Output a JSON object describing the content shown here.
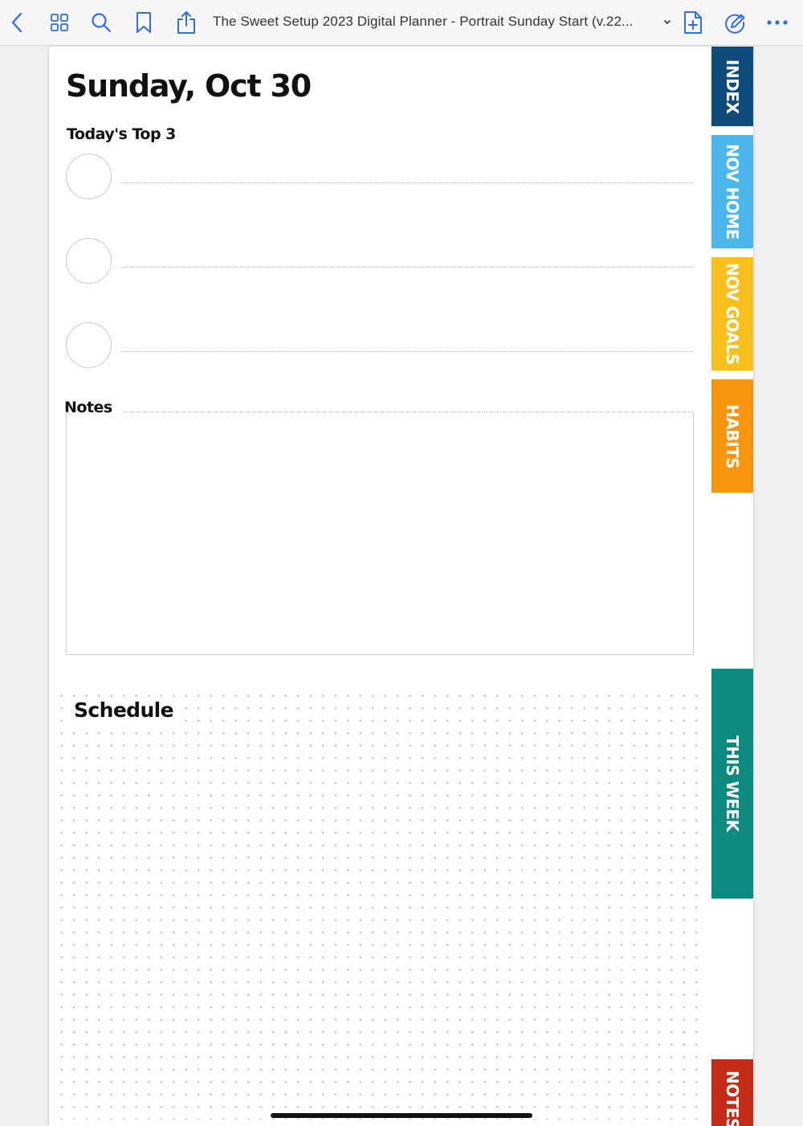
{
  "toolbar": {
    "document_title": "The Sweet Setup 2023 Digital Planner - Portrait Sunday Start (v.22...",
    "accent_color": "#2f6ee6",
    "icons": [
      "back-chevron-icon",
      "grid-icon",
      "search-icon",
      "bookmark-icon",
      "share-icon",
      "title-chevron-down-icon",
      "add-page-icon",
      "pencil-circle-icon",
      "more-icon"
    ]
  },
  "page": {
    "day_title": "Sunday, Oct 30",
    "top3_heading": "Today's Top 3",
    "notes_heading": "Notes",
    "schedule_heading": "Schedule"
  },
  "tabs": {
    "index": "INDEX",
    "nov_home": "NOV HOME",
    "nov_goals": "NOV GOALS",
    "habits": "HABITS",
    "this_week": "THIS WEEK",
    "notes": "NOTES"
  },
  "tab_colors": {
    "index": "#0f4c7c",
    "nov_home": "#4cb7eb",
    "nov_goals": "#f7c01c",
    "habits": "#f7960e",
    "this_week": "#0d8a80",
    "notes": "#c52c17"
  }
}
